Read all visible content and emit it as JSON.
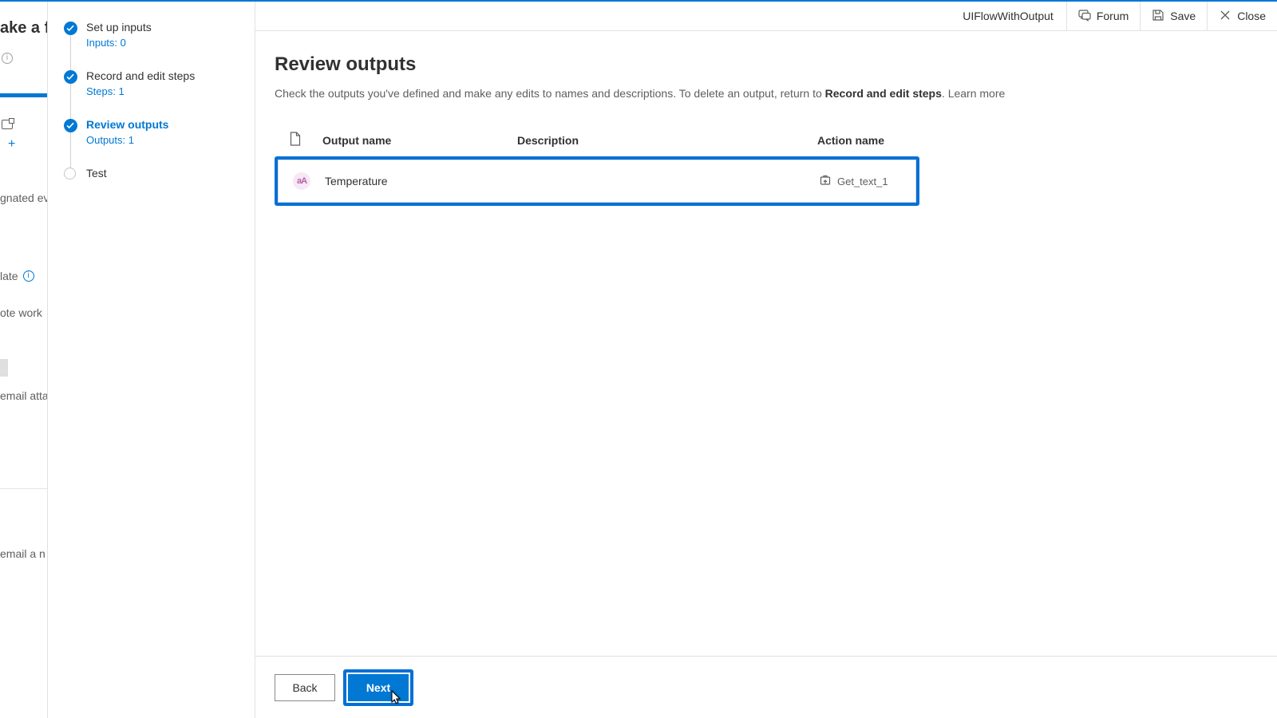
{
  "left_peek": {
    "title_fragment": "ake a fl",
    "frag1": "gnated even",
    "frag2": "late",
    "frag3": "ote work",
    "frag4": "email attac",
    "frag5": "email a n"
  },
  "header": {
    "flow_name": "UIFlowWithOutput",
    "forum": "Forum",
    "save": "Save",
    "close": "Close"
  },
  "steps": [
    {
      "title": "Set up inputs",
      "sub": "Inputs: 0",
      "state": "done"
    },
    {
      "title": "Record and edit steps",
      "sub": "Steps: 1",
      "state": "done"
    },
    {
      "title": "Review outputs",
      "sub": "Outputs: 1",
      "state": "active"
    },
    {
      "title": "Test",
      "sub": "",
      "state": "pending"
    }
  ],
  "page": {
    "title": "Review outputs",
    "desc_before": "Check the outputs you've defined and make any edits to names and descriptions. To delete an output, return to ",
    "desc_link": "Record and edit steps",
    "desc_after": ". ",
    "learn_more": "Learn more"
  },
  "table": {
    "cols": {
      "name": "Output name",
      "desc": "Description",
      "action": "Action name"
    },
    "rows": [
      {
        "badge": "aA",
        "name": "Temperature",
        "desc": "",
        "action": "Get_text_1"
      }
    ]
  },
  "footer": {
    "back": "Back",
    "next": "Next"
  }
}
